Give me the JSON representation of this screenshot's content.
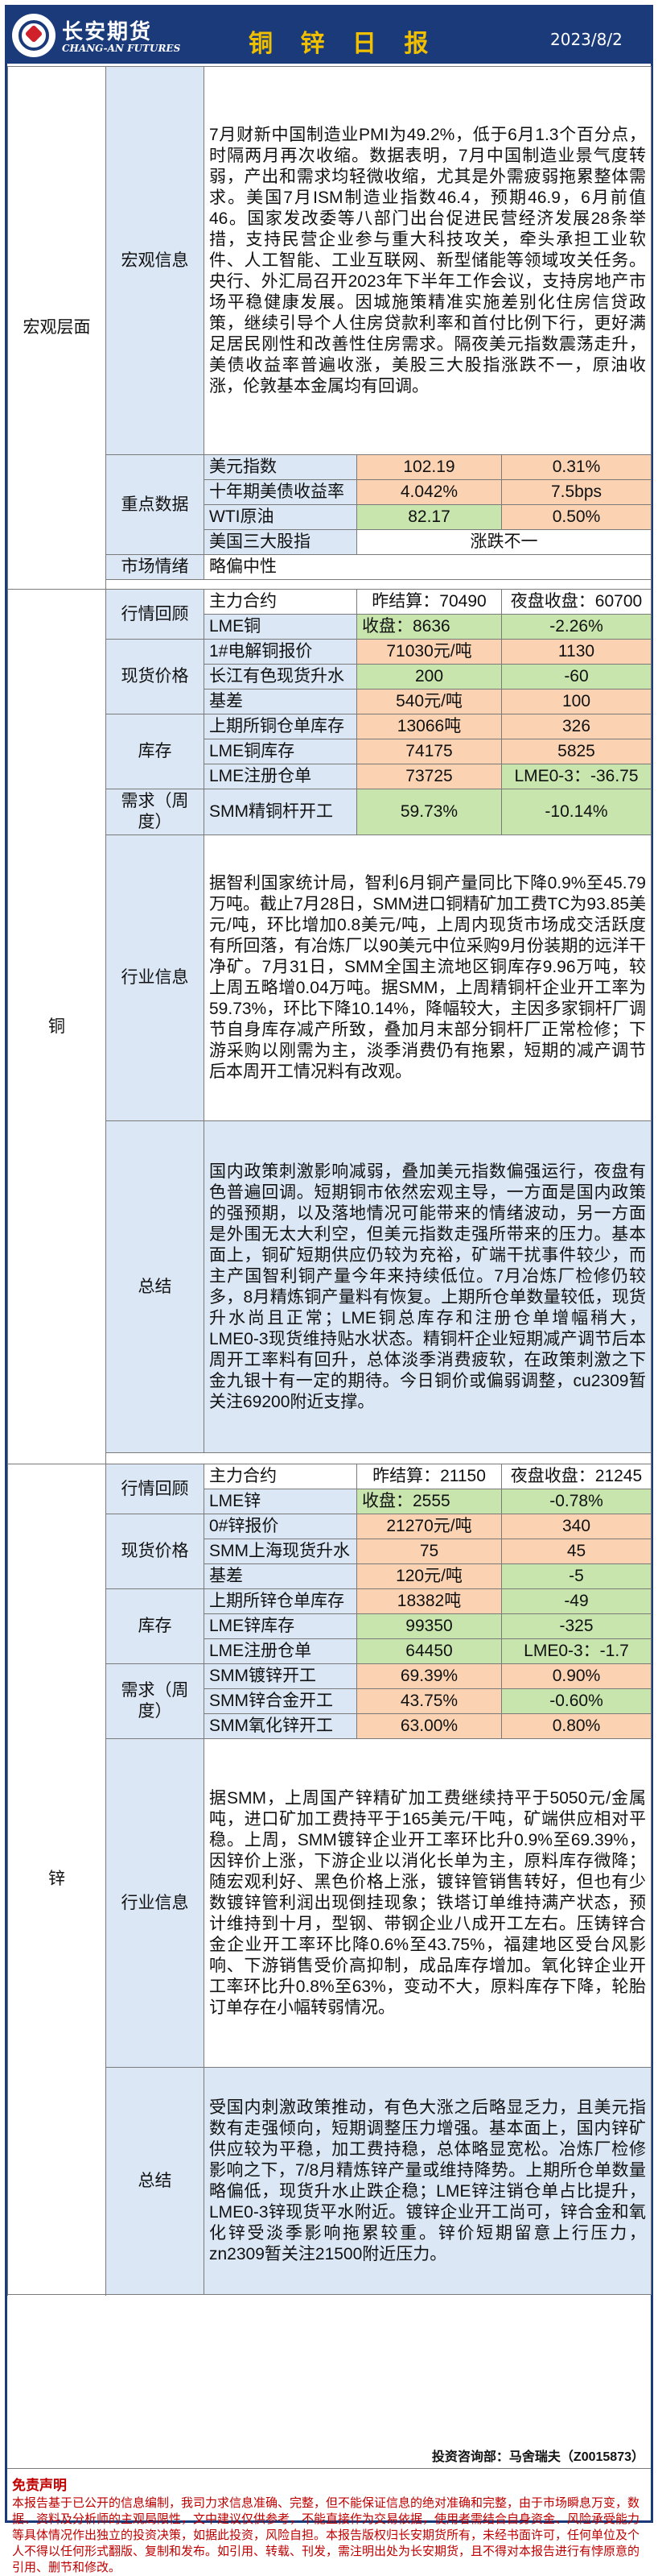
{
  "header": {
    "brand_cn": "长安期货",
    "brand_en": "CHANG-AN FUTURES",
    "title": "铜 锌 日 报",
    "date": "2023/8/2"
  },
  "macro": {
    "section": "宏观层面",
    "info_label": "宏观信息",
    "info_text": "7月财新中国制造业PMI为49.2%，低于6月1.3个百分点，时隔两月再次收缩。数据表明，7月中国制造业景气度转弱，产出和需求均轻微收缩，尤其是外需疲弱拖累整体需求。美国7月ISM制造业指数46.4，预期46.9，6月前值46。国家发改委等八部门出台促进民营经济发展28条举措，支持民营企业参与重大科技攻关，牵头承担工业软件、人工智能、工业互联网、新型储能等领域攻关任务。央行、外汇局召开2023年下半年工作会议，支持房地产市场平稳健康发展。因城施策精准实施差别化住房信贷政策，继续引导个人住房贷款利率和首付比例下行，更好满足居民刚性和改善性住房需求。隔夜美元指数震荡走升，美债收益率普遍收涨，美股三大股指涨跌不一，原油收涨，伦敦基本金属均有回调。",
    "key_label": "重点数据",
    "key_rows": [
      {
        "name": "美元指数",
        "value": "102.19",
        "change": "0.31%"
      },
      {
        "name": "十年期美债收益率",
        "value": "4.042%",
        "change": "7.5bps"
      },
      {
        "name": "WTI原油",
        "value": "82.17",
        "change": "0.50%"
      },
      {
        "name": "美国三大股指",
        "value": "涨跌不一"
      }
    ],
    "sentiment_label": "市场情绪",
    "sentiment_value": "略偏中性"
  },
  "copper": {
    "section": "铜",
    "price_label": "行情回顾",
    "contract_label": "主力合约",
    "settle": "昨结算：70490",
    "night": "夜盘收盘：60700",
    "lme_name": "LME铜",
    "lme_close": "收盘：8636",
    "lme_change": "-2.26%",
    "spot_label": "现货价格",
    "spot_rows": [
      {
        "name": "1#电解铜报价",
        "value": "71030元/吨",
        "change": "1130"
      },
      {
        "name": "长江有色现货升水",
        "value": "200",
        "change": "-60"
      },
      {
        "name": "基差",
        "value": "540元/吨",
        "change": "100"
      }
    ],
    "inv_label": "库存",
    "inv_rows": [
      {
        "name": "上期所铜仓单库存",
        "value": "13066吨",
        "change": "326"
      },
      {
        "name": "LME铜库存",
        "value": "74175",
        "change": "5825"
      },
      {
        "name": "LME注册仓单",
        "value": "73725",
        "change": "LME0-3：-36.75"
      }
    ],
    "demand_label": "需求（周度）",
    "demand_rows": [
      {
        "name": "SMM精铜杆开工",
        "value": "59.73%",
        "change": "-10.14%"
      }
    ],
    "industry_label": "行业信息",
    "industry_text": "据智利国家统计局，智利6月铜产量同比下降0.9%至45.79万吨。截止7月28日，SMM进口铜精矿加工费TC为93.85美元/吨，环比增加0.8美元/吨，上周内现货市场成交活跃度有所回落，有冶炼厂以90美元中位采购9月份装期的远洋干净矿。7月31日，SMM全国主流地区铜库存9.96万吨，较上周五略增0.04万吨。据SMM，上周精铜杆企业开工率为59.73%，环比下降10.14%，降幅较大，主因多家铜杆厂调节自身库存减产所致，叠加月末部分铜杆厂正常检修；下游采购以刚需为主，淡季消费仍有拖累，短期的减产调节后本周开工情况料有改观。",
    "summary_label": "总结",
    "summary_text": "国内政策刺激影响减弱，叠加美元指数偏强运行，夜盘有色普遍回调。短期铜市依然宏观主导，一方面是国内政策的强预期，以及落地情况可能带来的情绪波动，另一方面是外围无太大利空，但美元指数走强所带来的压力。基本面上，铜矿短期供应仍较为充裕，矿端干扰事件较少，而主产国智利铜产量今年来持续低位。7月冶炼厂检修仍较多，8月精炼铜产量料有恢复。上期所仓单数量较低，现货升水尚且正常；LME铜总库存和注册仓单增幅稍大，LME0-3现货维持贴水状态。精铜杆企业短期减产调节后本周开工率料有回升，总体淡季消费疲软，在政策刺激之下金九银十有一定的期待。今日铜价或偏弱调整，cu2309暂关注69200附近支撑。"
  },
  "zinc": {
    "section": "锌",
    "price_label": "行情回顾",
    "contract_label": "主力合约",
    "settle": "昨结算：21150",
    "night": "夜盘收盘：21245",
    "lme_name": "LME锌",
    "lme_close": "收盘：2555",
    "lme_change": "-0.78%",
    "spot_label": "现货价格",
    "spot_rows": [
      {
        "name": "0#锌报价",
        "value": "21270元/吨",
        "change": "340"
      },
      {
        "name": "SMM上海现货升水",
        "value": "75",
        "change": "45"
      },
      {
        "name": "基差",
        "value": "120元/吨",
        "change": "-5"
      }
    ],
    "inv_label": "库存",
    "inv_rows": [
      {
        "name": "上期所锌仓单库存",
        "value": "18382吨",
        "change": "-49"
      },
      {
        "name": "LME锌库存",
        "value": "99350",
        "change": "-325"
      },
      {
        "name": "LME注册仓单",
        "value": "64450",
        "change": "LME0-3：-1.7"
      }
    ],
    "demand_label": "需求（周度）",
    "demand_rows": [
      {
        "name": "SMM镀锌开工",
        "value": "69.39%",
        "change": "0.90%"
      },
      {
        "name": "SMM锌合金开工",
        "value": "43.75%",
        "change": "-0.60%"
      },
      {
        "name": "SMM氧化锌开工",
        "value": "63.00%",
        "change": "0.80%"
      }
    ],
    "industry_label": "行业信息",
    "industry_text": "据SMM，上周国产锌精矿加工费继续持平于5050元/金属吨，进口矿加工费持平于165美元/干吨，矿端供应相对平稳。上周，SMM镀锌企业开工率环比升0.9%至69.39%，因锌价上涨，下游企业以消化长单为主，原料库存微降；随宏观利好、黑色价格上涨，镀锌管销售转好，但也有少数镀锌管利润出现倒挂现象；铁塔订单维持满产状态，预计维持到十月，型钢、带钢企业八成开工左右。压铸锌合金企业开工率环比降0.6%至43.75%，福建地区受台风影响、下游销售受价高抑制，成品库存增加。氧化锌企业开工率环比升0.8%至63%，变动不大，原料库存下降，轮胎订单存在小幅转弱情况。",
    "summary_label": "总结",
    "summary_text": "受国内刺激政策推动，有色大涨之后略显乏力，且美元指数有走强倾向，短期调整压力增强。基本面上，国内锌矿供应较为平稳，加工费持稳，总体略显宽松。冶炼厂检修影响之下，7/8月精炼锌产量或维持降势。上期所仓单数量略偏低，现货升水止跌企稳；LME锌注销仓单占比提升，LME0-3锌现货平水附近。镀锌企业开工尚可，锌合金和氧化锌受淡季影响拖累较重。锌价短期留意上行压力，zn2309暂关注21500附近压力。"
  },
  "footer": {
    "analyst": "投资咨询部：马舍瑞夫（Z0015873）",
    "disclaimer_title": "免责声明",
    "disclaimer_text": "本报告基于已公开的信息编制，我司力求信息准确、完整，但不能保证信息的绝对准确和完整，由于市场瞬息万变，数据、资料及分析师的主观局限性，文中建议仅供参考，不能直接作为交易依据，使用者需结合自身资金、风险承受能力等具体情况作出独立的投资决策，如据此投资，风险自担。本报告版权归长安期货所有，未经书面许可，任何单位及个人不得以任何形式翻版、复制和发布。如引用、转载、刊发，需注明出处为长安期货，且不得对本报告进行有悖原意的引用、删节和修改。"
  }
}
